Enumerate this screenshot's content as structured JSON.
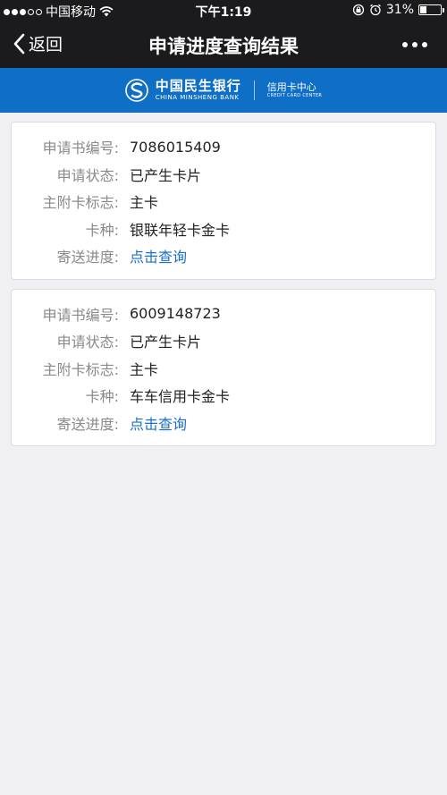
{
  "status_bar": {
    "carrier": "中国移动",
    "time": "下午1:19",
    "battery_percent": "31%",
    "battery_level": 0.31
  },
  "nav": {
    "back_label": "返回",
    "title": "申请进度查询结果"
  },
  "banner": {
    "name_cn": "中国民生银行",
    "name_en": "CHINA MINSHENG BANK",
    "sub_cn": "信用卡中心",
    "sub_en": "CREDIT CARD CENTER"
  },
  "cards": [
    {
      "rows": [
        {
          "label": "申请书编号:",
          "value": "7086015409"
        },
        {
          "label": "申请状态:",
          "value": "已产生卡片"
        },
        {
          "label": "主附卡标志:",
          "value": "主卡"
        },
        {
          "label": "卡种:",
          "value": "银联年轻卡金卡"
        },
        {
          "label": "寄送进度:",
          "value": "点击查询"
        }
      ]
    },
    {
      "rows": [
        {
          "label": "申请书编号:",
          "value": "6009148723"
        },
        {
          "label": "申请状态:",
          "value": "已产生卡片"
        },
        {
          "label": "主附卡标志:",
          "value": "主卡"
        },
        {
          "label": "卡种:",
          "value": "车车信用卡金卡"
        },
        {
          "label": "寄送进度:",
          "value": "点击查询"
        }
      ]
    }
  ],
  "colors": {
    "topbar": "#1b1b1d",
    "banner": "#0f6fc6",
    "link": "#1a6fc6"
  }
}
